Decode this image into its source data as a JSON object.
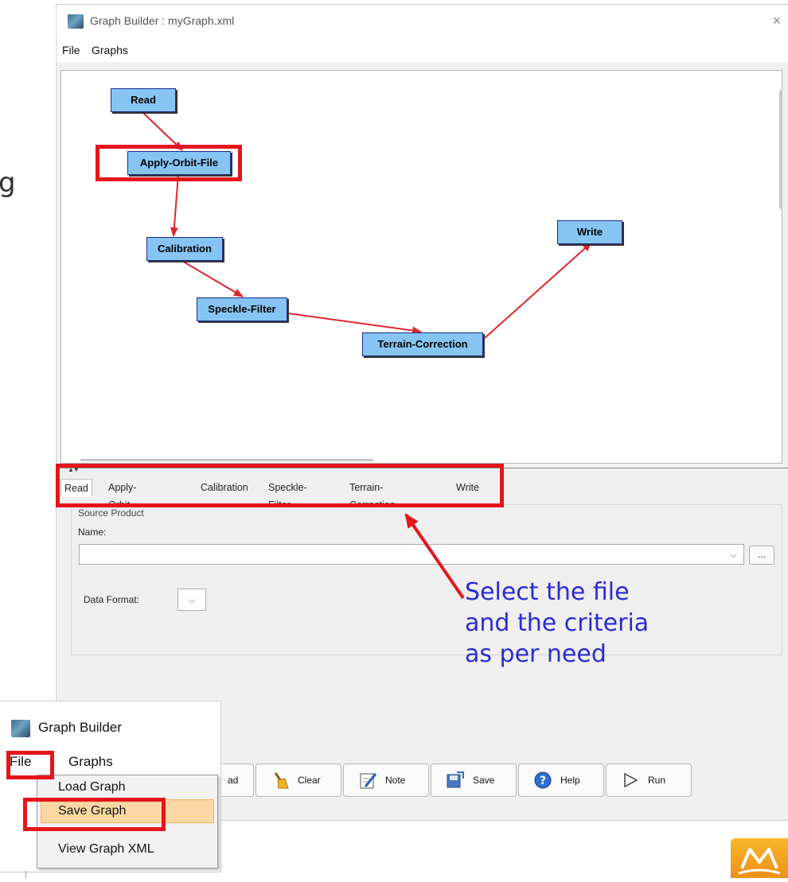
{
  "window": {
    "title": "Graph Builder : myGraph.xml",
    "close_glyph": "×",
    "menus": [
      "File",
      "Graphs"
    ]
  },
  "graph": {
    "nodes": {
      "read": "Read",
      "apply_orbit": "Apply-Orbit-File",
      "calibration": "Calibration",
      "speckle": "Speckle-Filter",
      "terrain": "Terrain-Correction",
      "write": "Write"
    },
    "node_color": "#86c5f3",
    "edge_color": "#e0262b"
  },
  "tabs": [
    "Read",
    "Apply-Orbit-File",
    "Calibration",
    "Speckle-Filter",
    "Terrain-Correction",
    "Write"
  ],
  "read_panel": {
    "section_label": "Source Product",
    "name_label": "Name:",
    "name_value": "",
    "browse_label": "...",
    "data_format_label": "Data Format:",
    "data_format_value": ""
  },
  "buttons": {
    "load_partial": "ad",
    "clear": "Clear",
    "note": "Note",
    "save": "Save",
    "help": "Help",
    "run": "Run"
  },
  "annotation": {
    "line1": "Select the file",
    "line2": "and the criteria",
    "line3": "as per need",
    "color": "#2b2bd4",
    "clipped_letter": "g"
  },
  "inset": {
    "title": "Graph Builder",
    "menus": [
      "File",
      "Graphs"
    ],
    "dropdown_items": [
      "Load Graph",
      "Save Graph",
      "View Graph XML"
    ],
    "selected_item": "Save Graph"
  },
  "icons": [
    "app-icon",
    "close-icon",
    "broom-icon",
    "note-icon",
    "save-icon",
    "help-icon",
    "play-icon",
    "chevron-down-icon",
    "logo-icon"
  ],
  "highlight_color": "#e5151c"
}
